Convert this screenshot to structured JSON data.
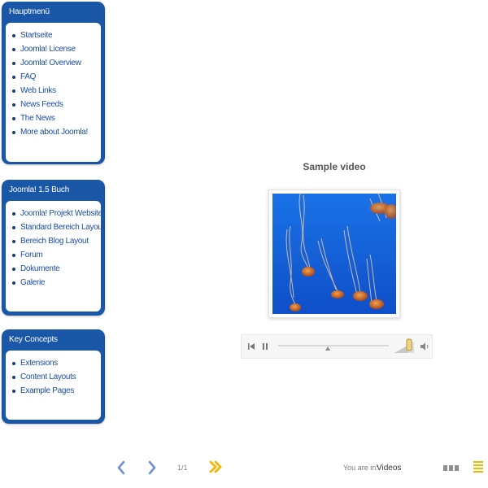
{
  "sidebar": {
    "modules": [
      {
        "title": "Hauptmenü",
        "items": [
          "Startseite",
          "Joomla! License",
          "Joomla! Overview",
          "FAQ",
          "Web Links",
          "News Feeds",
          "The News",
          "More about Joomla!"
        ]
      },
      {
        "title": "Joomla! 1.5 Buch",
        "items": [
          "Joomla! Projekt Website",
          "Standard Bereich Layout",
          "Bereich Blog Layout",
          "Forum",
          "Dokumente",
          "Galerie"
        ]
      },
      {
        "title": "Key Concepts",
        "items": [
          "Extensions",
          "Content Layouts",
          "Example Pages"
        ]
      }
    ]
  },
  "video": {
    "title": "Sample video",
    "thumbnail_icon": "jellyfish-thumbnail",
    "controls": {
      "previous_icon": "skip-back-icon",
      "pause_icon": "pause-icon",
      "volume_icon": "speaker-icon",
      "progress": 0.45
    }
  },
  "footer": {
    "prev_icon": "chevron-left-icon",
    "next_icon": "chevron-right-icon",
    "page": "1/1",
    "fast_forward_icon": "double-chevron-right-icon",
    "breadcrumb_label": "You are in:",
    "breadcrumb_value": "Videos",
    "grid_view_icon": "grid-view-icon",
    "list_view_icon": "list-view-icon"
  },
  "colors": {
    "module_blue": "#1b57a7",
    "link_blue": "#1c4ea0",
    "chevron_blue": "#6b8fd6",
    "accent_yellow": "#f2b705",
    "water_blue": "#1565d8"
  }
}
